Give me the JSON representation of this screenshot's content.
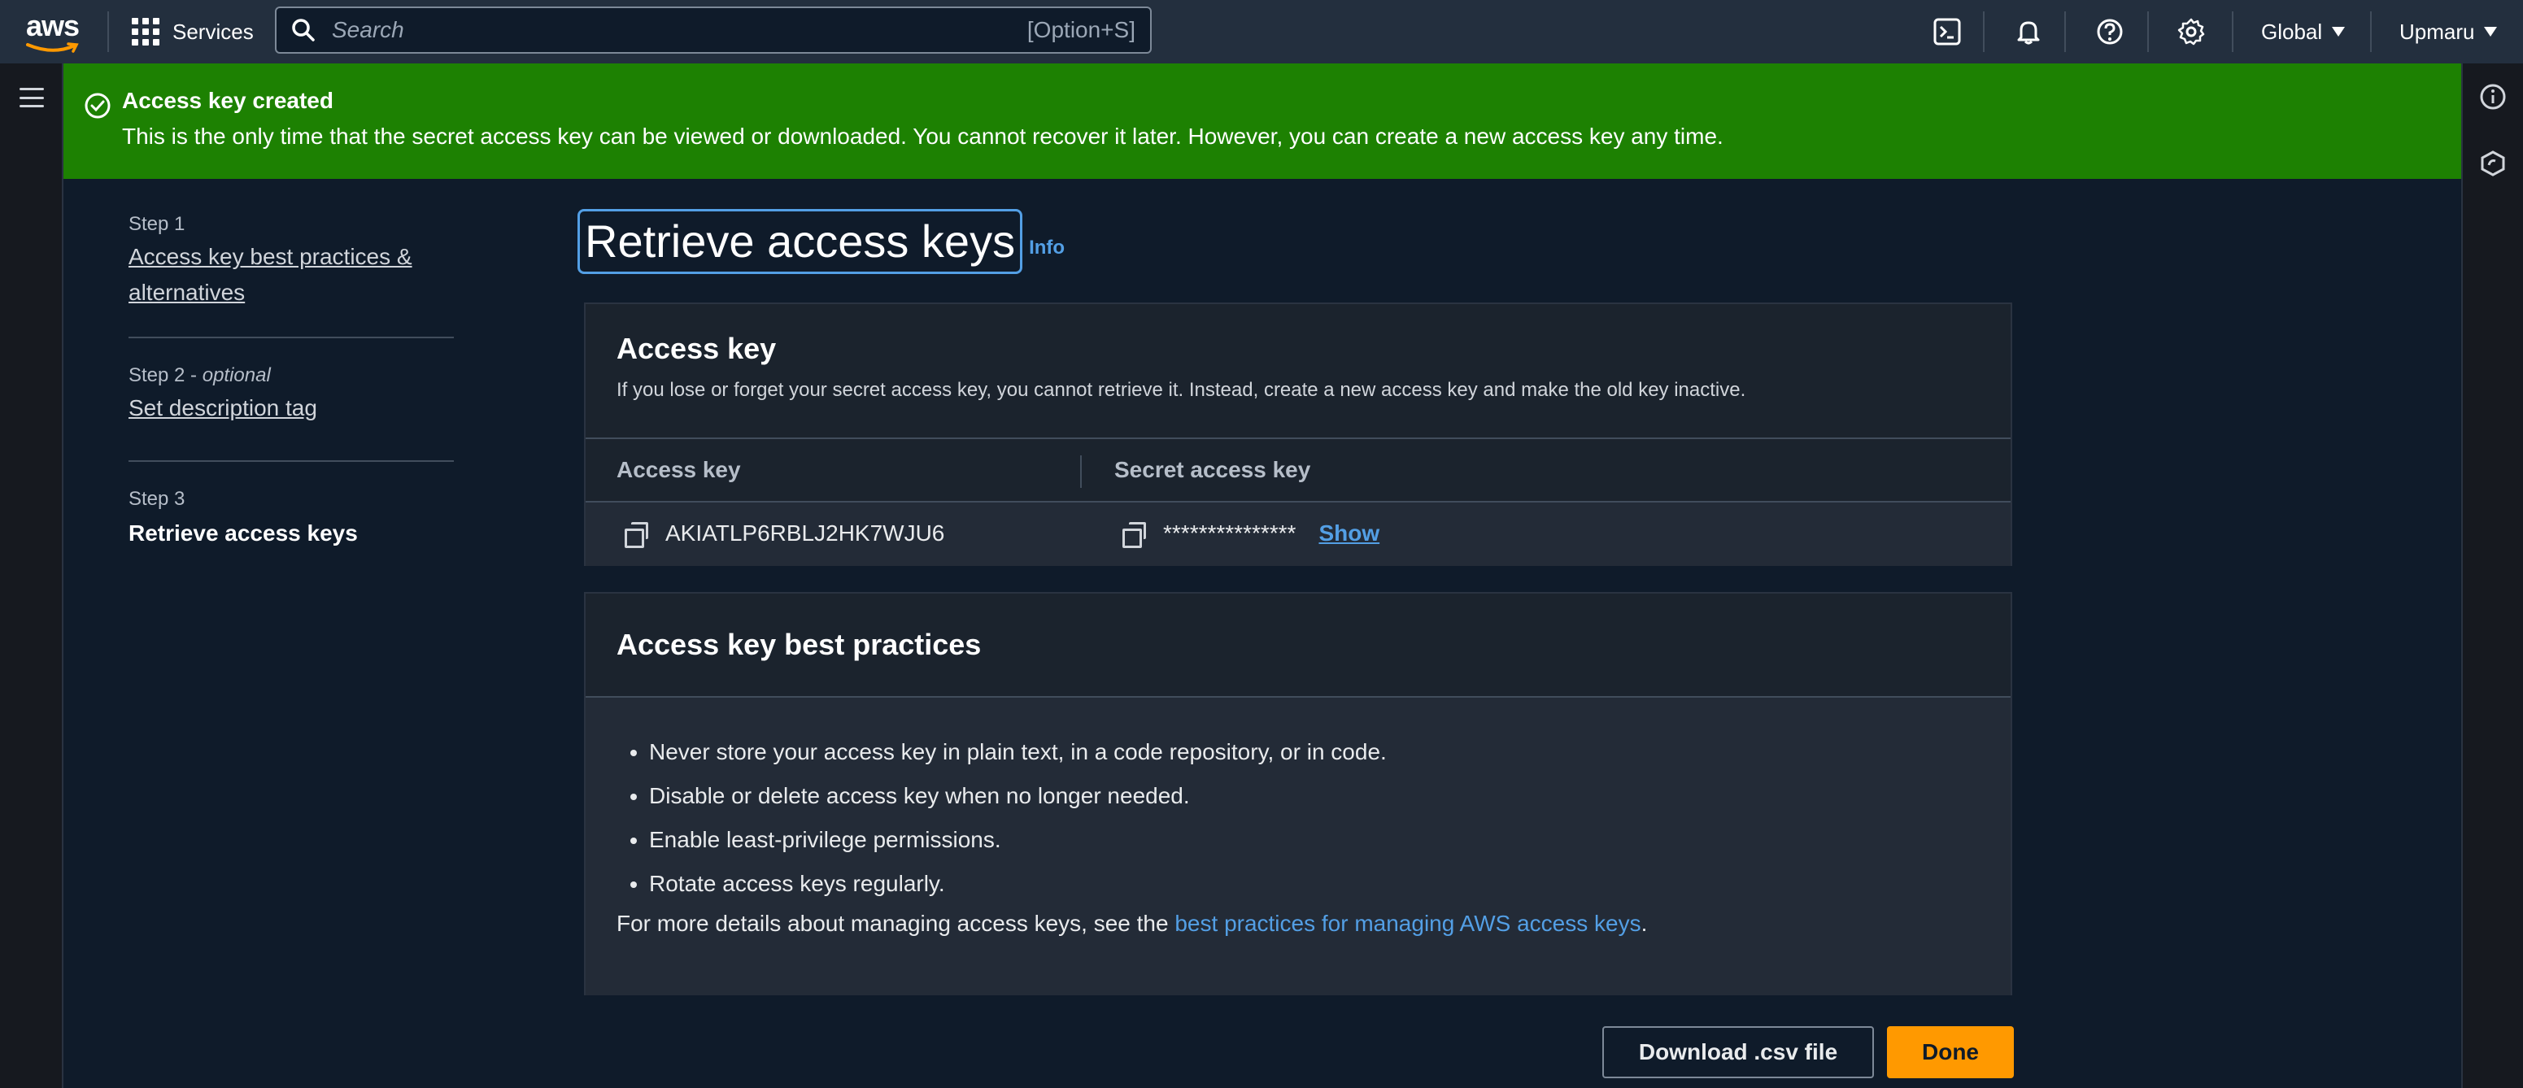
{
  "nav": {
    "logo_text": "aws",
    "services_label": "Services",
    "search_placeholder": "Search",
    "search_shortcut": "[Option+S]",
    "region_label": "Global",
    "account_label": "Upmaru"
  },
  "flash": {
    "title": "Access key created",
    "message": "This is the only time that the secret access key can be viewed or downloaded. You cannot recover it later. However, you can create a new access key any time.",
    "color": "#1d8102"
  },
  "steps": [
    {
      "number": "Step 1",
      "label": "Access key best practices & alternatives"
    },
    {
      "number": "Step 2",
      "optional": "optional",
      "label": "Set description tag"
    },
    {
      "number": "Step 3",
      "label": "Retrieve access keys"
    }
  ],
  "page": {
    "title": "Retrieve access keys",
    "info_label": "Info"
  },
  "access_key_card": {
    "title": "Access key",
    "description": "If you lose or forget your secret access key, you cannot retrieve it. Instead, create a new access key and make the old key inactive.",
    "columns": [
      "Access key",
      "Secret access key"
    ],
    "access_key_value": "AKIATLP6RBLJ2HK7WJU6",
    "secret_masked": "***************",
    "show_label": "Show"
  },
  "best_practices_card": {
    "title": "Access key best practices",
    "items": [
      "Never store your access key in plain text, in a code repository, or in code.",
      "Disable or delete access key when no longer needed.",
      "Enable least-privilege permissions.",
      "Rotate access keys regularly."
    ],
    "note_prefix": "For more details about managing access keys, see the ",
    "note_link": "best practices for managing AWS access keys",
    "note_suffix": "."
  },
  "buttons": {
    "download_label": "Download .csv file",
    "done_label": "Done",
    "primary_color": "#ff9900"
  }
}
